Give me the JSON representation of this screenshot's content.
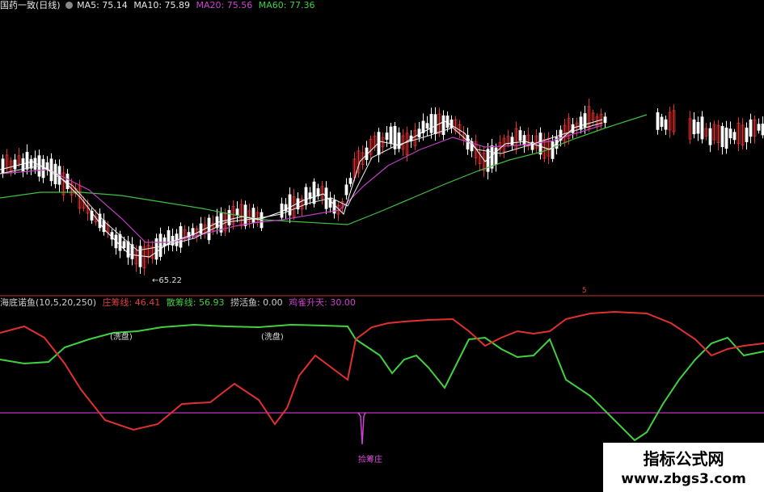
{
  "price_header": {
    "stock": "国药一致(日线)",
    "ma5": "MA5: 75.14",
    "ma10": "MA10: 75.89",
    "ma20": "MA20: 75.56",
    "ma60": "MA60: 77.36"
  },
  "indicator_header": {
    "name": "海底诺鱼(10,5,20,250)",
    "zhuang": "庄筹线: 46.41",
    "san": "散筹线: 56.93",
    "zhua": "捞活鱼: 0.00",
    "que": "鸡雀升天: 30.00"
  },
  "annotations": {
    "low": "←65.22",
    "xipan1": "(洗盘)",
    "xipan2": "(洗盘)",
    "jiechen": "捡筹庄",
    "marker": "5"
  },
  "watermark": {
    "title": "指标公式网",
    "url": "www.zbgs3.com"
  },
  "colors": {
    "up": "#e03030",
    "down": "#ffffff",
    "ma5": "#ffffff",
    "ma10": "#ffffff",
    "ma20": "#c040c0",
    "ma60": "#40c040",
    "zhuang_line": "#e03030",
    "san_line": "#40d040",
    "divider": "#c030c0"
  }
}
